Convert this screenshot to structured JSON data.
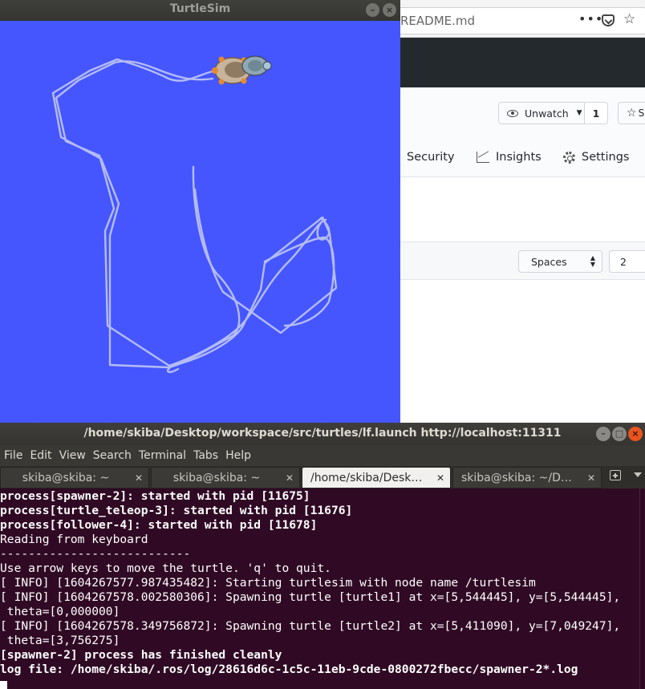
{
  "browser": {
    "url_text": "README.md",
    "url_dots": "•••",
    "star_glyph": "☆",
    "unwatch_label": "Unwatch",
    "watch_count": "1",
    "star_button_glyph": "☆",
    "star_button_label": "S",
    "nav": {
      "security": "Security",
      "insights": "Insights",
      "settings": "Settings"
    },
    "indent_mode": "Spaces",
    "indent_size": "2"
  },
  "turtlesim": {
    "title": "TurtleSim",
    "background_color": "#4556ff",
    "path_color": "#b4bcf4"
  },
  "terminal": {
    "title": "/home/skiba/Desktop/workspace/src/turtles/lf.launch http://localhost:11311",
    "menu": [
      "File",
      "Edit",
      "View",
      "Search",
      "Terminal",
      "Tabs",
      "Help"
    ],
    "tabs": [
      {
        "label": "skiba@skiba: ~",
        "active": false
      },
      {
        "label": "skiba@skiba: ~",
        "active": false
      },
      {
        "label": "/home/skiba/Deskt…",
        "active": true
      },
      {
        "label": "skiba@skiba: ~/Des…",
        "active": false
      }
    ],
    "lines": [
      {
        "text": "process[spawner-2]: started with pid [11675]",
        "bold": true
      },
      {
        "text": "process[turtle_teleop-3]: started with pid [11676]",
        "bold": true
      },
      {
        "text": "process[follower-4]: started with pid [11678]",
        "bold": true
      },
      {
        "text": "Reading from keyboard",
        "bold": false
      },
      {
        "text": "---------------------------",
        "bold": false
      },
      {
        "text": "Use arrow keys to move the turtle. 'q' to quit.",
        "bold": false
      },
      {
        "text": "[ INFO] [1604267577.987435482]: Starting turtlesim with node name /turtlesim",
        "bold": false
      },
      {
        "text": "[ INFO] [1604267578.002580306]: Spawning turtle [turtle1] at x=[5,544445], y=[5,544445],",
        "bold": false
      },
      {
        "text": " theta=[0,000000]",
        "bold": false
      },
      {
        "text": "[ INFO] [1604267578.349756872]: Spawning turtle [turtle2] at x=[5,411090], y=[7,049247],",
        "bold": false
      },
      {
        "text": " theta=[3,756275]",
        "bold": false
      },
      {
        "text": "[spawner-2] process has finished cleanly",
        "bold": true
      },
      {
        "text": "log file: /home/skiba/.ros/log/28616d6c-1c5c-11eb-9cde-0800272fbecc/spawner-2*.log",
        "bold": true
      }
    ],
    "background_color": "#300a24"
  }
}
